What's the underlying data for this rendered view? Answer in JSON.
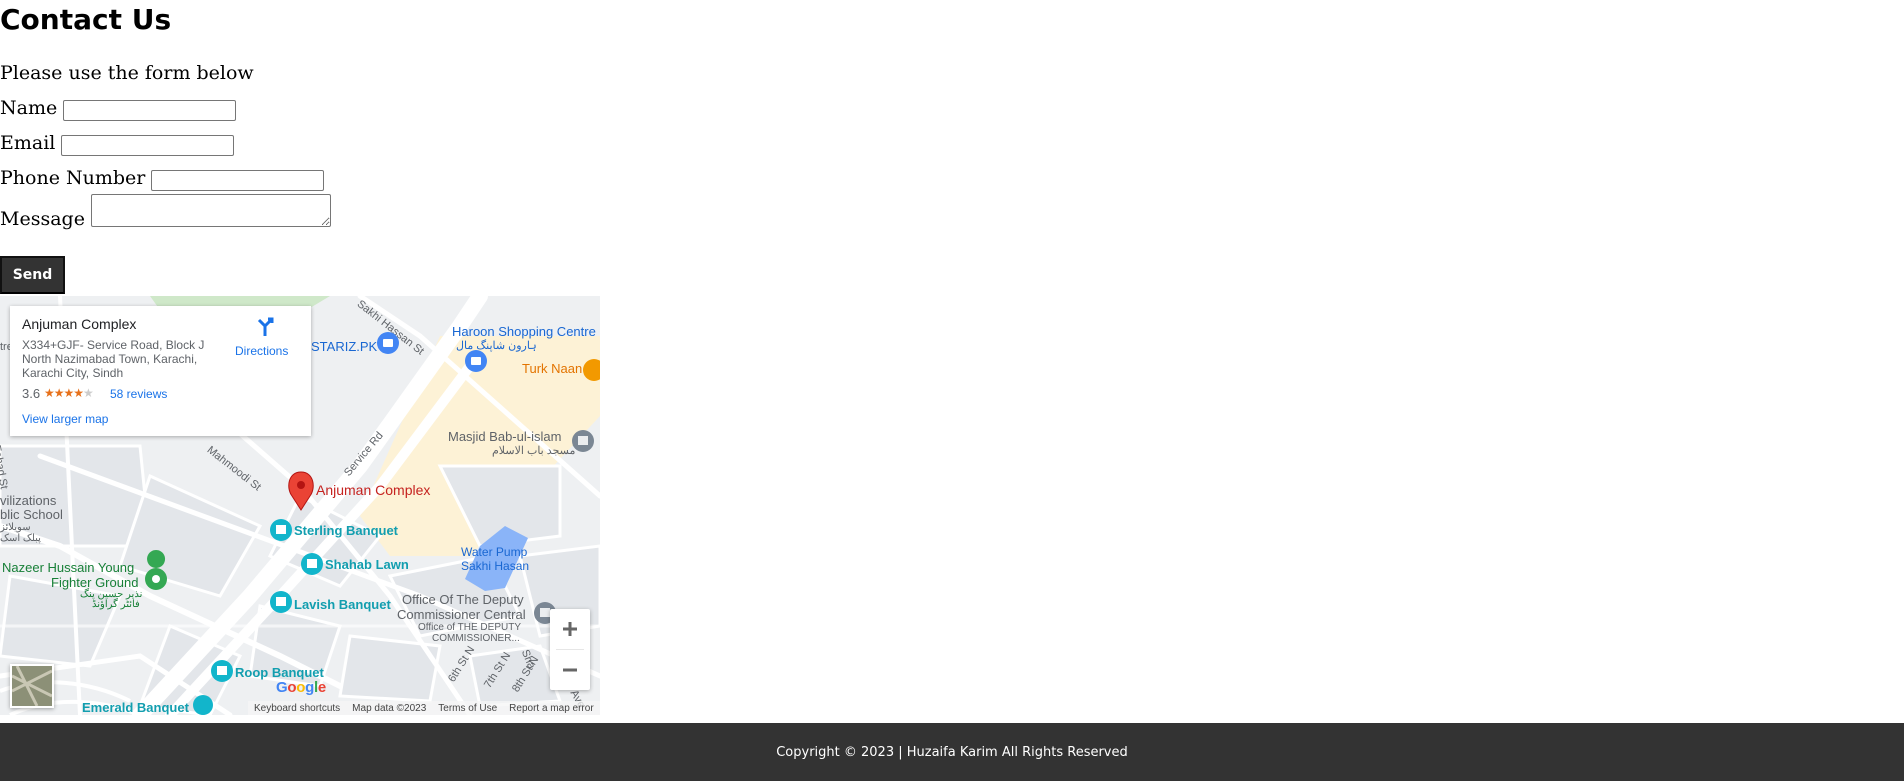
{
  "page": {
    "title": "Contact Us",
    "intro": "Please use the form below"
  },
  "form": {
    "name_label": "Name",
    "email_label": "Email",
    "phone_label": "Phone Number",
    "message_label": "Message",
    "name_value": "",
    "email_value": "",
    "phone_value": "",
    "message_value": "",
    "send_label": "Send"
  },
  "map": {
    "place_name": "Anjuman Complex",
    "address": "X334+GJF- Service Road, Block J North Nazimabad Town, Karachi, Karachi City, Sindh",
    "rating": "3.6",
    "stars_filled": 3.5,
    "reviews": "58 reviews",
    "view_larger": "View larger map",
    "directions": "Directions",
    "marker_label": "Anjuman Complex",
    "labels": {
      "haroon": "Haroon Shopping Centre",
      "haroon_ur": "ہارون شاپنگ مال",
      "turk": "Turk Naan",
      "stariz": "STARIZ.PK",
      "masjid": "Masjid Bab-ul-islam",
      "masjid_ur": "مسجد باب الاسلام",
      "sterling": "Sterling Banquet",
      "shahab": "Shahab Lawn",
      "lavish": "Lavish Banquet",
      "roop": "Roop Banquet",
      "emerald": "Emerald Banquet",
      "nazeer1": "Nazeer Hussain Young",
      "nazeer2": "Fighter Ground",
      "nazeer_ur1": "نذیر حسین ینگ",
      "nazeer_ur2": "فائٹر گراؤنڈ",
      "water1": "Water Pump",
      "water2": "Sakhi Hasan",
      "office1": "Office Of The Deputy",
      "office2": "Commissioner Central",
      "office3": "Office of THE DEPUTY",
      "office4": "COMMISSIONER...",
      "civ1": "vilizations",
      "civ2": "blic School",
      "civ_ur1": "سویلائز",
      "civ_ur2": "پبلک اسک",
      "mahmoodi": "Mahmoodi St",
      "service": "Service Rd",
      "sakhi": "Sakhi Hassan St",
      "fahad": "Fahad St",
      "st6": "6th St N",
      "st7": "7th St N",
      "st8": "8th St N",
      "sha": "Sha",
      "ave": "Ave",
      "tre": "tre"
    },
    "google": "Google",
    "attribution": {
      "shortcuts": "Keyboard shortcuts",
      "data": "Map data ©2023",
      "terms": "Terms of Use",
      "report": "Report a map error"
    }
  },
  "footer": {
    "text": "Copyright © 2023 | Huzaifa Karim All Rights Reserved"
  }
}
